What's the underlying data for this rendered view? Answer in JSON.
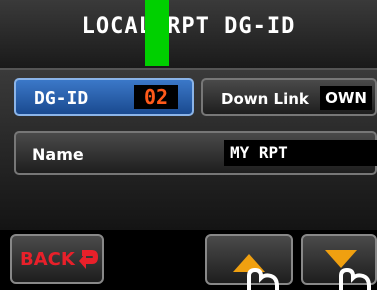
{
  "header": {
    "title": "LOCAL RPT DG-ID"
  },
  "dgid": {
    "label": "DG-ID",
    "value": "02"
  },
  "downlink": {
    "label": "Down Link",
    "value": "OWN"
  },
  "name": {
    "label": "Name",
    "value": "MY RPT"
  },
  "footer": {
    "back_label": "BACK",
    "up_icon": "arrow-up-icon",
    "down_icon": "arrow-down-icon"
  },
  "colors": {
    "accent_blue": "#2f6bbf",
    "dgid_value": "#ff5a1a",
    "back_red": "#e8202a",
    "arrow_orange": "#f0a010",
    "marker_green": "#00d000"
  }
}
